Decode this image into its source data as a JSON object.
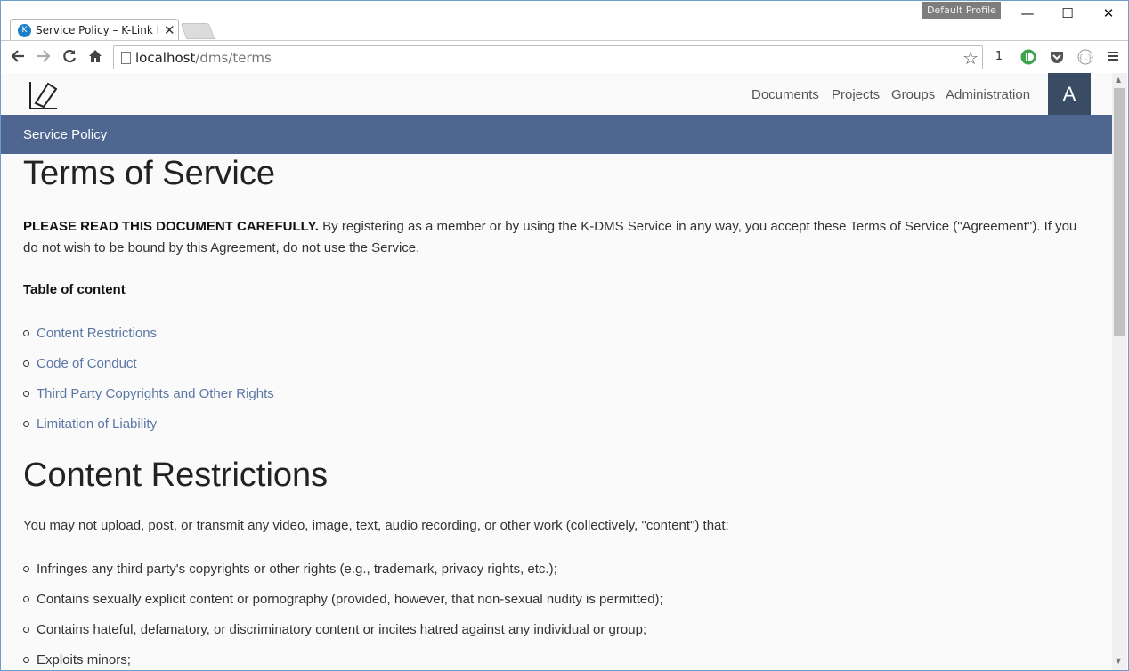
{
  "browser": {
    "tab_title": "Service Policy – K-Link DM",
    "tab_close": "✕",
    "profile_label": "Default Profile",
    "window_controls": {
      "minimize": "—",
      "maximize": "☐",
      "close": "✕"
    },
    "url_host": "localhost",
    "url_path": "/dms/terms",
    "star": "☆",
    "extension_badge": "1",
    "icons": [
      "back-icon",
      "forward-icon",
      "reload-icon",
      "home-icon",
      "page-icon",
      "bookmark-star-icon",
      "ghostery-icon",
      "pocket-icon",
      "extension-icon",
      "menu-icon"
    ]
  },
  "app": {
    "nav": [
      "Documents",
      "Projects",
      "Groups",
      "Administration"
    ],
    "avatar_letter": "A",
    "subheader": "Service Policy",
    "colors": {
      "subheader": "#4e6690",
      "avatar": "#3a4c63",
      "link": "#5b77a5"
    }
  },
  "document": {
    "title": "Terms of Service",
    "intro_bold": "PLEASE READ THIS DOCUMENT CAREFULLY.",
    "intro_rest": " By registering as a member or by using the K-DMS Service in any way, you accept these Terms of Service (\"Agreement\"). If you do not wish to be bound by this Agreement, do not use the Service.",
    "toc_title": "Table of content",
    "toc": [
      "Content Restrictions",
      "Code of Conduct",
      "Third Party Copyrights and Other Rights",
      "Limitation of Liability"
    ],
    "section1_title": "Content Restrictions",
    "section1_intro": "You may not upload, post, or transmit any video, image, text, audio recording, or other work (collectively, \"content\") that:",
    "section1_items": [
      "Infringes any third party's copyrights or other rights (e.g., trademark, privacy rights, etc.);",
      "Contains sexually explicit content or pornography (provided, however, that non-sexual nudity is permitted);",
      "Contains hateful, defamatory, or discriminatory content or incites hatred against any individual or group;",
      "Exploits minors;"
    ]
  }
}
